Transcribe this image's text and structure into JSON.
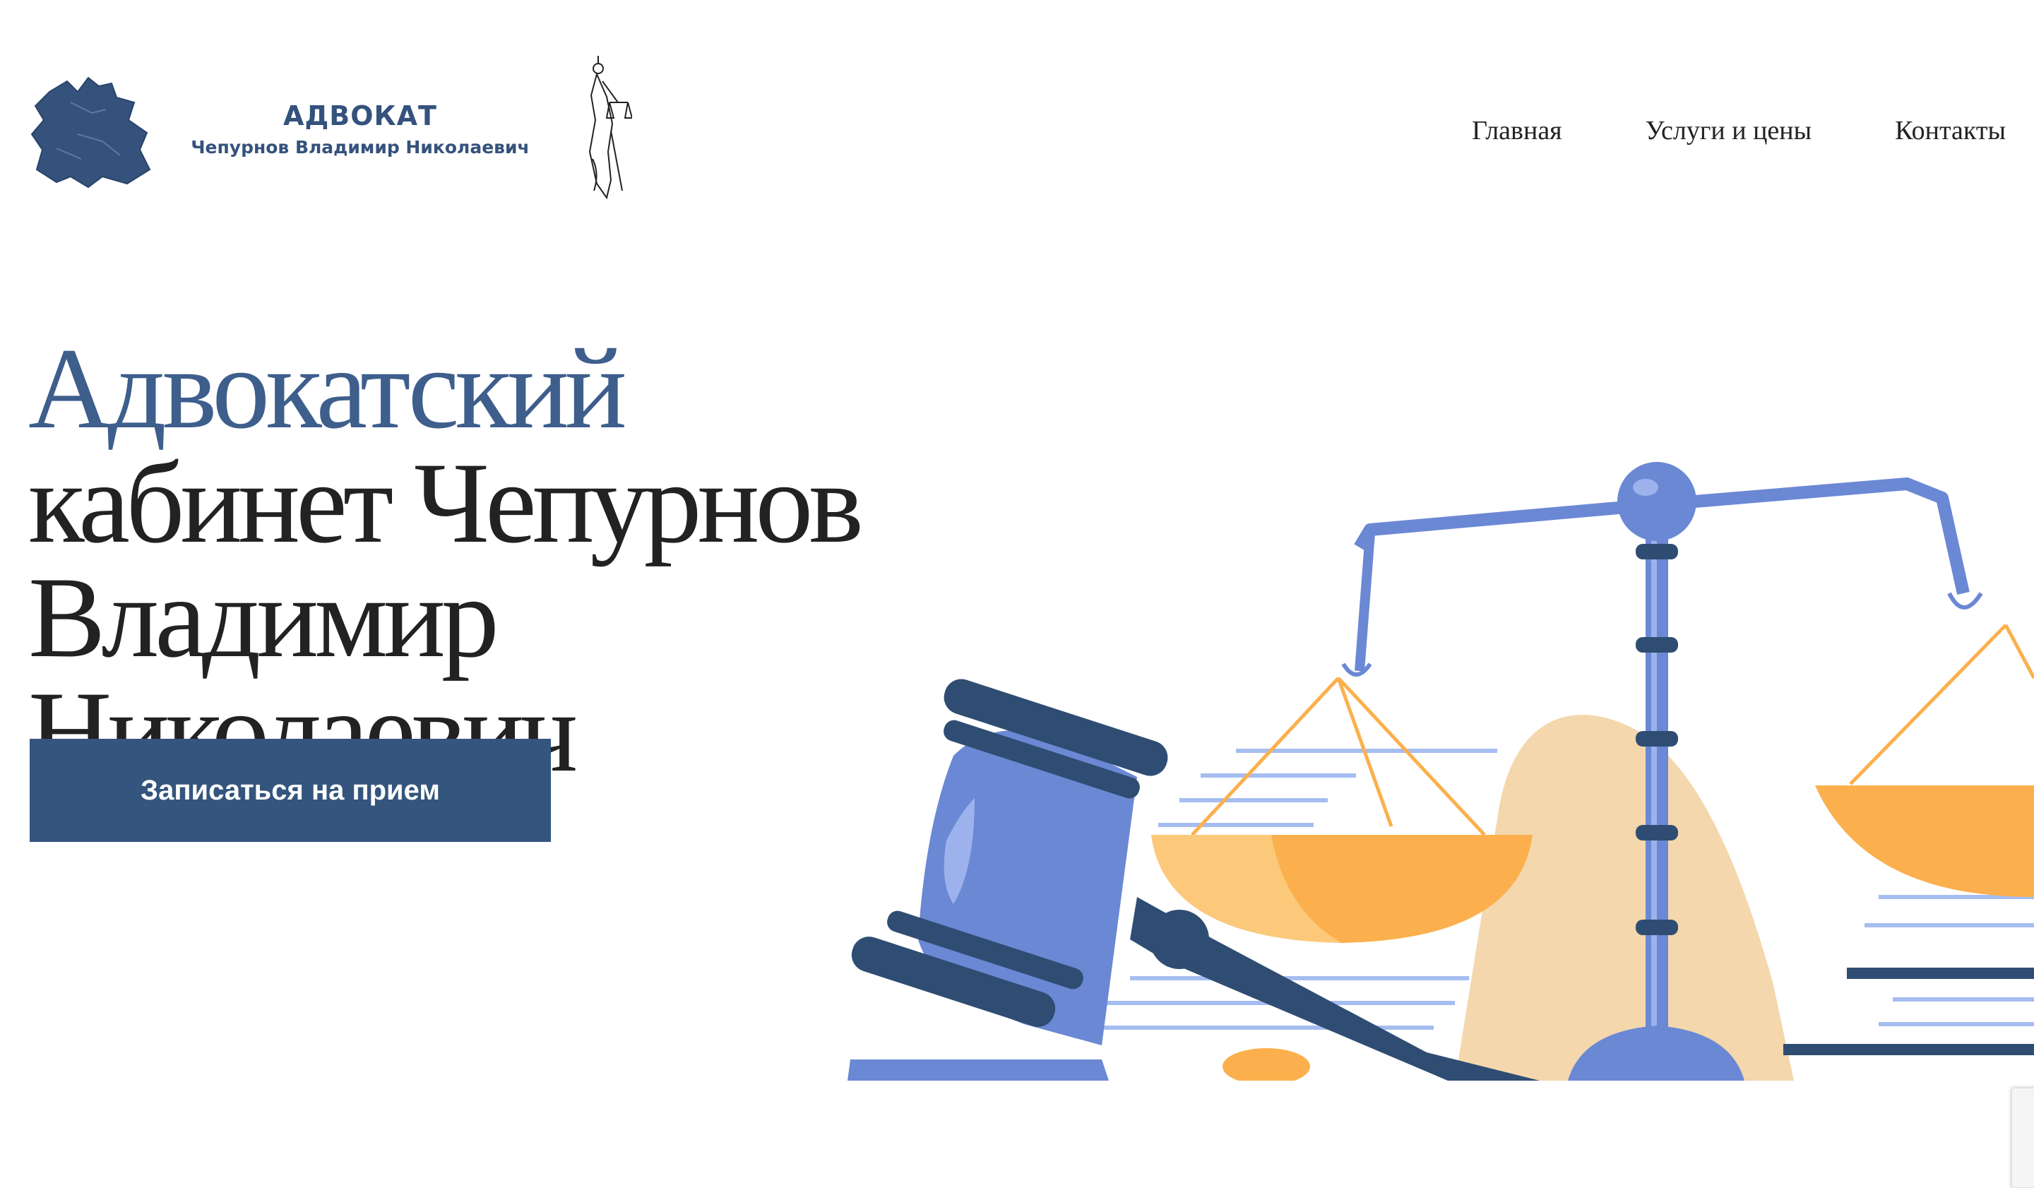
{
  "header": {
    "logo": {
      "title": "АДВОКАТ",
      "subtitle": "Чепурнов Владимир Николаевич"
    },
    "nav": [
      {
        "label": "Главная"
      },
      {
        "label": "Услуги и цены"
      },
      {
        "label": "Контакты"
      }
    ]
  },
  "hero": {
    "title_accent": "Адвокатский",
    "title_rest": "кабинет Чепурнов Владимир Николаевич",
    "cta_label": "Записаться на прием"
  },
  "colors": {
    "brand_blue": "#34557d",
    "accent_blue": "#3e5e8c",
    "scale_blue": "#6b88d4",
    "gavel_dark": "#2f4d73",
    "pan_orange": "#fbb04d",
    "background_beige": "#f4d7ad"
  },
  "icons": [
    "region-map-logo-icon",
    "themis-statue-icon",
    "scales-of-justice-illustration",
    "gavel-illustration"
  ]
}
